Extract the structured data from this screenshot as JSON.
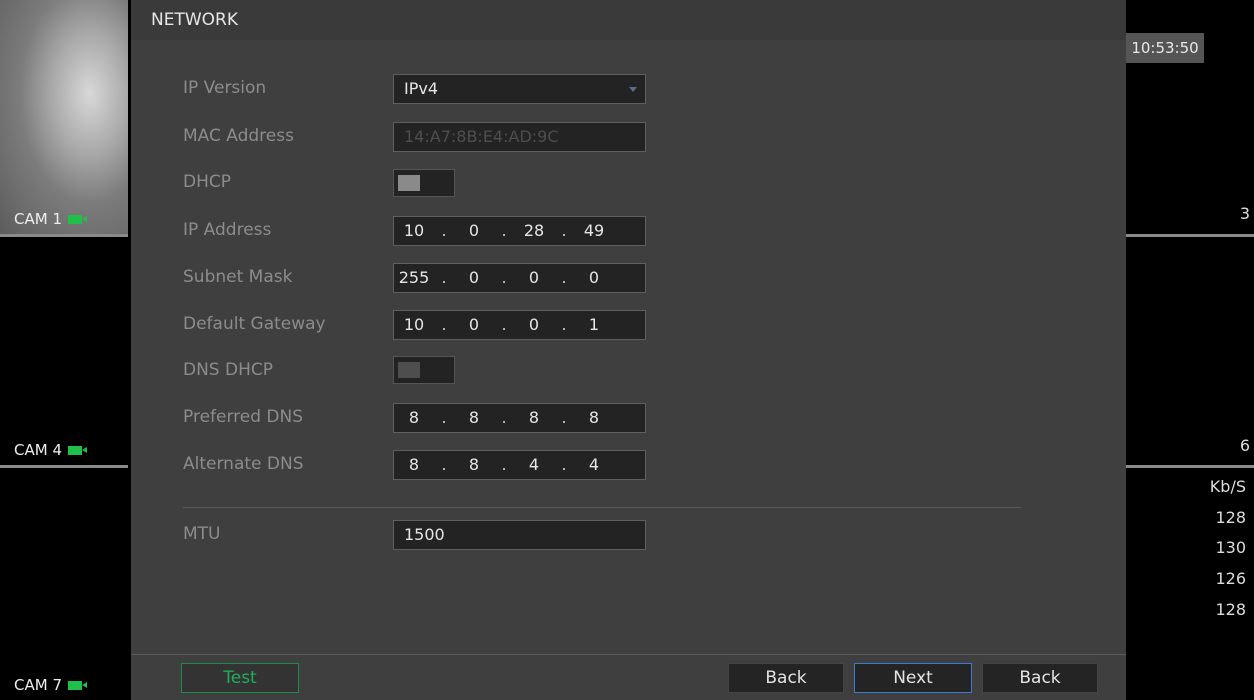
{
  "cameras": [
    {
      "label": "CAM 1"
    },
    {
      "label": "CAM 4"
    },
    {
      "label": "CAM 7"
    }
  ],
  "right": {
    "clock": "10:53:50",
    "channel_numbers": [
      "3",
      "6"
    ],
    "bitrate_unit": "Kb/S",
    "bitrates": [
      "128",
      "130",
      "126",
      "128"
    ]
  },
  "dialog": {
    "title": "NETWORK",
    "ip_version": {
      "label": "IP Version",
      "value": "IPv4"
    },
    "mac": {
      "label": "MAC Address",
      "value": "14:A7:8B:E4:AD:9C"
    },
    "dhcp": {
      "label": "DHCP",
      "enabled": false
    },
    "ip_address": {
      "label": "IP Address",
      "octets": [
        "10",
        "0",
        "28",
        "49"
      ]
    },
    "subnet": {
      "label": "Subnet Mask",
      "octets": [
        "255",
        "0",
        "0",
        "0"
      ]
    },
    "gateway": {
      "label": "Default Gateway",
      "octets": [
        "10",
        "0",
        "0",
        "1"
      ]
    },
    "dns_dhcp": {
      "label": "DNS DHCP",
      "enabled": false
    },
    "preferred_dns": {
      "label": "Preferred DNS",
      "octets": [
        "8",
        "8",
        "8",
        "8"
      ]
    },
    "alternate_dns": {
      "label": "Alternate DNS",
      "octets": [
        "8",
        "8",
        "4",
        "4"
      ]
    },
    "mtu": {
      "label": "MTU",
      "value": "1500"
    },
    "buttons": {
      "test": "Test",
      "back": "Back",
      "next": "Next",
      "back2": "Back"
    }
  },
  "colors": {
    "accent_green": "#1fae5a",
    "focus_blue": "#3b7bd1"
  }
}
